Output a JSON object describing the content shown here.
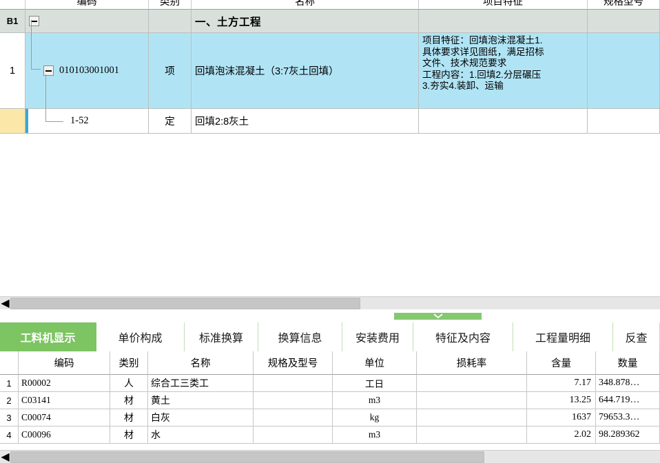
{
  "top_grid": {
    "columns": [
      "",
      "编码",
      "类别",
      "名称",
      "项目特征",
      "规格型号"
    ],
    "rows": [
      {
        "index": "B1",
        "code": "",
        "category": "",
        "name": "一、土方工程",
        "feature": "",
        "spec": "",
        "style": "group",
        "expander": "collapse-box"
      },
      {
        "index": "1",
        "code": "010103001001",
        "category": "项",
        "name": "回填泡沫混凝土（3:7灰土回填）",
        "feature": "项目特征：回填泡沫混凝土1.\n具体要求详见图纸，满足招标\n文件、技术规范要求\n工程内容：1.回填2.分层碾压\n3.夯实4.装卸、运输",
        "spec": "",
        "style": "selected",
        "expander": "collapse-box"
      },
      {
        "index": "",
        "code": "1-52",
        "category": "定",
        "name": "回填2:8灰土",
        "feature": "",
        "spec": "",
        "style": "child",
        "expander": "none"
      }
    ]
  },
  "splitter": {
    "chevron_icon": "chevron-down-icon",
    "color": "#85c870"
  },
  "scrollbars": {
    "top_left_arrow": "◀",
    "bottom_left_arrow": "◀"
  },
  "tabs": {
    "active_index": 0,
    "items": [
      {
        "label": "工料机显示"
      },
      {
        "label": "单价构成"
      },
      {
        "label": "标准换算"
      },
      {
        "label": "换算信息"
      },
      {
        "label": "安装费用"
      },
      {
        "label": "特征及内容"
      },
      {
        "label": "工程量明细"
      },
      {
        "label": "反查"
      }
    ]
  },
  "bottom_grid": {
    "columns": [
      "",
      "编码",
      "类别",
      "名称",
      "规格及型号",
      "单位",
      "损耗率",
      "含量",
      "数量"
    ],
    "rows": [
      {
        "index": "1",
        "code": "R00002",
        "category": "人",
        "name": "综合工三类工",
        "spec": "",
        "unit": "工日",
        "loss": "",
        "content": "7.17",
        "quantity": "348.878…"
      },
      {
        "index": "2",
        "code": "C03141",
        "category": "材",
        "name": "黄土",
        "spec": "",
        "unit": "m3",
        "loss": "",
        "content": "13.25",
        "quantity": "644.719…"
      },
      {
        "index": "3",
        "code": "C00074",
        "category": "材",
        "name": "白灰",
        "spec": "",
        "unit": "kg",
        "loss": "",
        "content": "1637",
        "quantity": "79653.3…"
      },
      {
        "index": "4",
        "code": "C00096",
        "category": "材",
        "name": "水",
        "spec": "",
        "unit": "m3",
        "loss": "",
        "content": "2.02",
        "quantity": "98.289362"
      }
    ]
  },
  "colors": {
    "selection_blue": "#b0e4f5",
    "group_row_gray": "#d9e0dc",
    "marker_yellow": "#fbe8a8",
    "tab_green": "#7dc463",
    "edge_blue": "#3aa8d0"
  }
}
